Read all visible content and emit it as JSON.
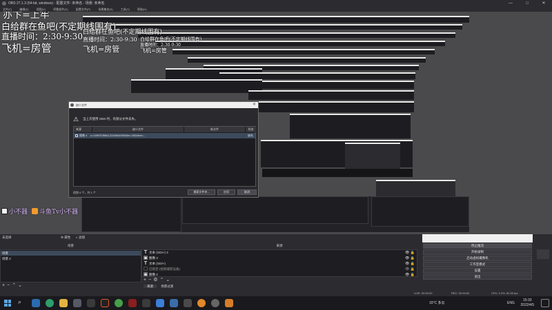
{
  "window": {
    "title": "OBS 27.1.3 (64-bit, windows) - 配置文件: 未命名 - 场景: 未命名",
    "buttons": [
      "—",
      "□",
      "✕"
    ]
  },
  "menu": [
    "文件(F)",
    "编辑(E)",
    "视图(V)",
    "停靠部件(D)",
    "配置文件(P)",
    "场景集合(S)",
    "工具(T)",
    "帮助(H)"
  ],
  "overlay": {
    "big_line1": "亦卞=上牢",
    "big_line2": "白给群在鱼吧(不定期线围有)",
    "big_line3": "直播时间：2:30-9:30",
    "big_line4": "飞机=房管",
    "mid_line2": "白给群在鱼吧(不定期线围有)",
    "mid_line3": "直播时间：2:30-9:30",
    "mid_line4": "飞机=房管",
    "sm_line2": "白给群在鱼吧(不定期线围有)",
    "sm_line3": "直播时间：2:30-9:30",
    "sm_line4": "飞机=房管",
    "bottom_left": "小不器",
    "bottom_right": "斗鱼Tv小不器"
  },
  "dialog": {
    "title": "缺少文件",
    "close": "✕",
    "message": "当上次使用 OBS 时，有部分文件丢失。",
    "columns": [
      "来源",
      "缺少文件",
      "新文件",
      "状态"
    ],
    "row": {
      "source": "图像 4",
      "missing": "u=1699378884,2240844909&fm=253&fmt=...",
      "new": "",
      "status": "缺失"
    },
    "found": "找到 0 个，共 1 个",
    "buttons": [
      "搜索文件夹...",
      "应用",
      "取消"
    ]
  },
  "docks": {
    "scenes_header": "场景",
    "sources_header": "来源",
    "scene_filter": "未选择",
    "filters_btn": "属性",
    "filters_btn2": "滤镜",
    "scenes": [
      "场景",
      "场景 2"
    ],
    "sources": [
      {
        "icon": "T",
        "label": "文本 (GDI+) 3"
      },
      {
        "icon": "▣",
        "label": "图像 3"
      },
      {
        "icon": "T",
        "label": "文本 (GDI+)"
      },
      {
        "icon": "▢",
        "label": "已锁定-(视频捕获设备)"
      },
      {
        "icon": "▣",
        "label": "图像 2"
      }
    ],
    "tabs": [
      "来源",
      "场景过渡"
    ],
    "controls": [
      "停止推流",
      "开始录制",
      "启动虚拟摄像机",
      "工作室模式",
      "设置",
      "退出"
    ]
  },
  "status": {
    "live": "LIVE: 00:00:00",
    "rec": "REC: 00:00:00",
    "cpu": "CPU: 2.0%, 60.00 fps",
    "dropped": "丢帧 0 (0.0%)"
  },
  "taskbar": {
    "weather": "16°C 多云",
    "lang": "ENG",
    "time": "15:33",
    "date": "2022/4/5"
  }
}
